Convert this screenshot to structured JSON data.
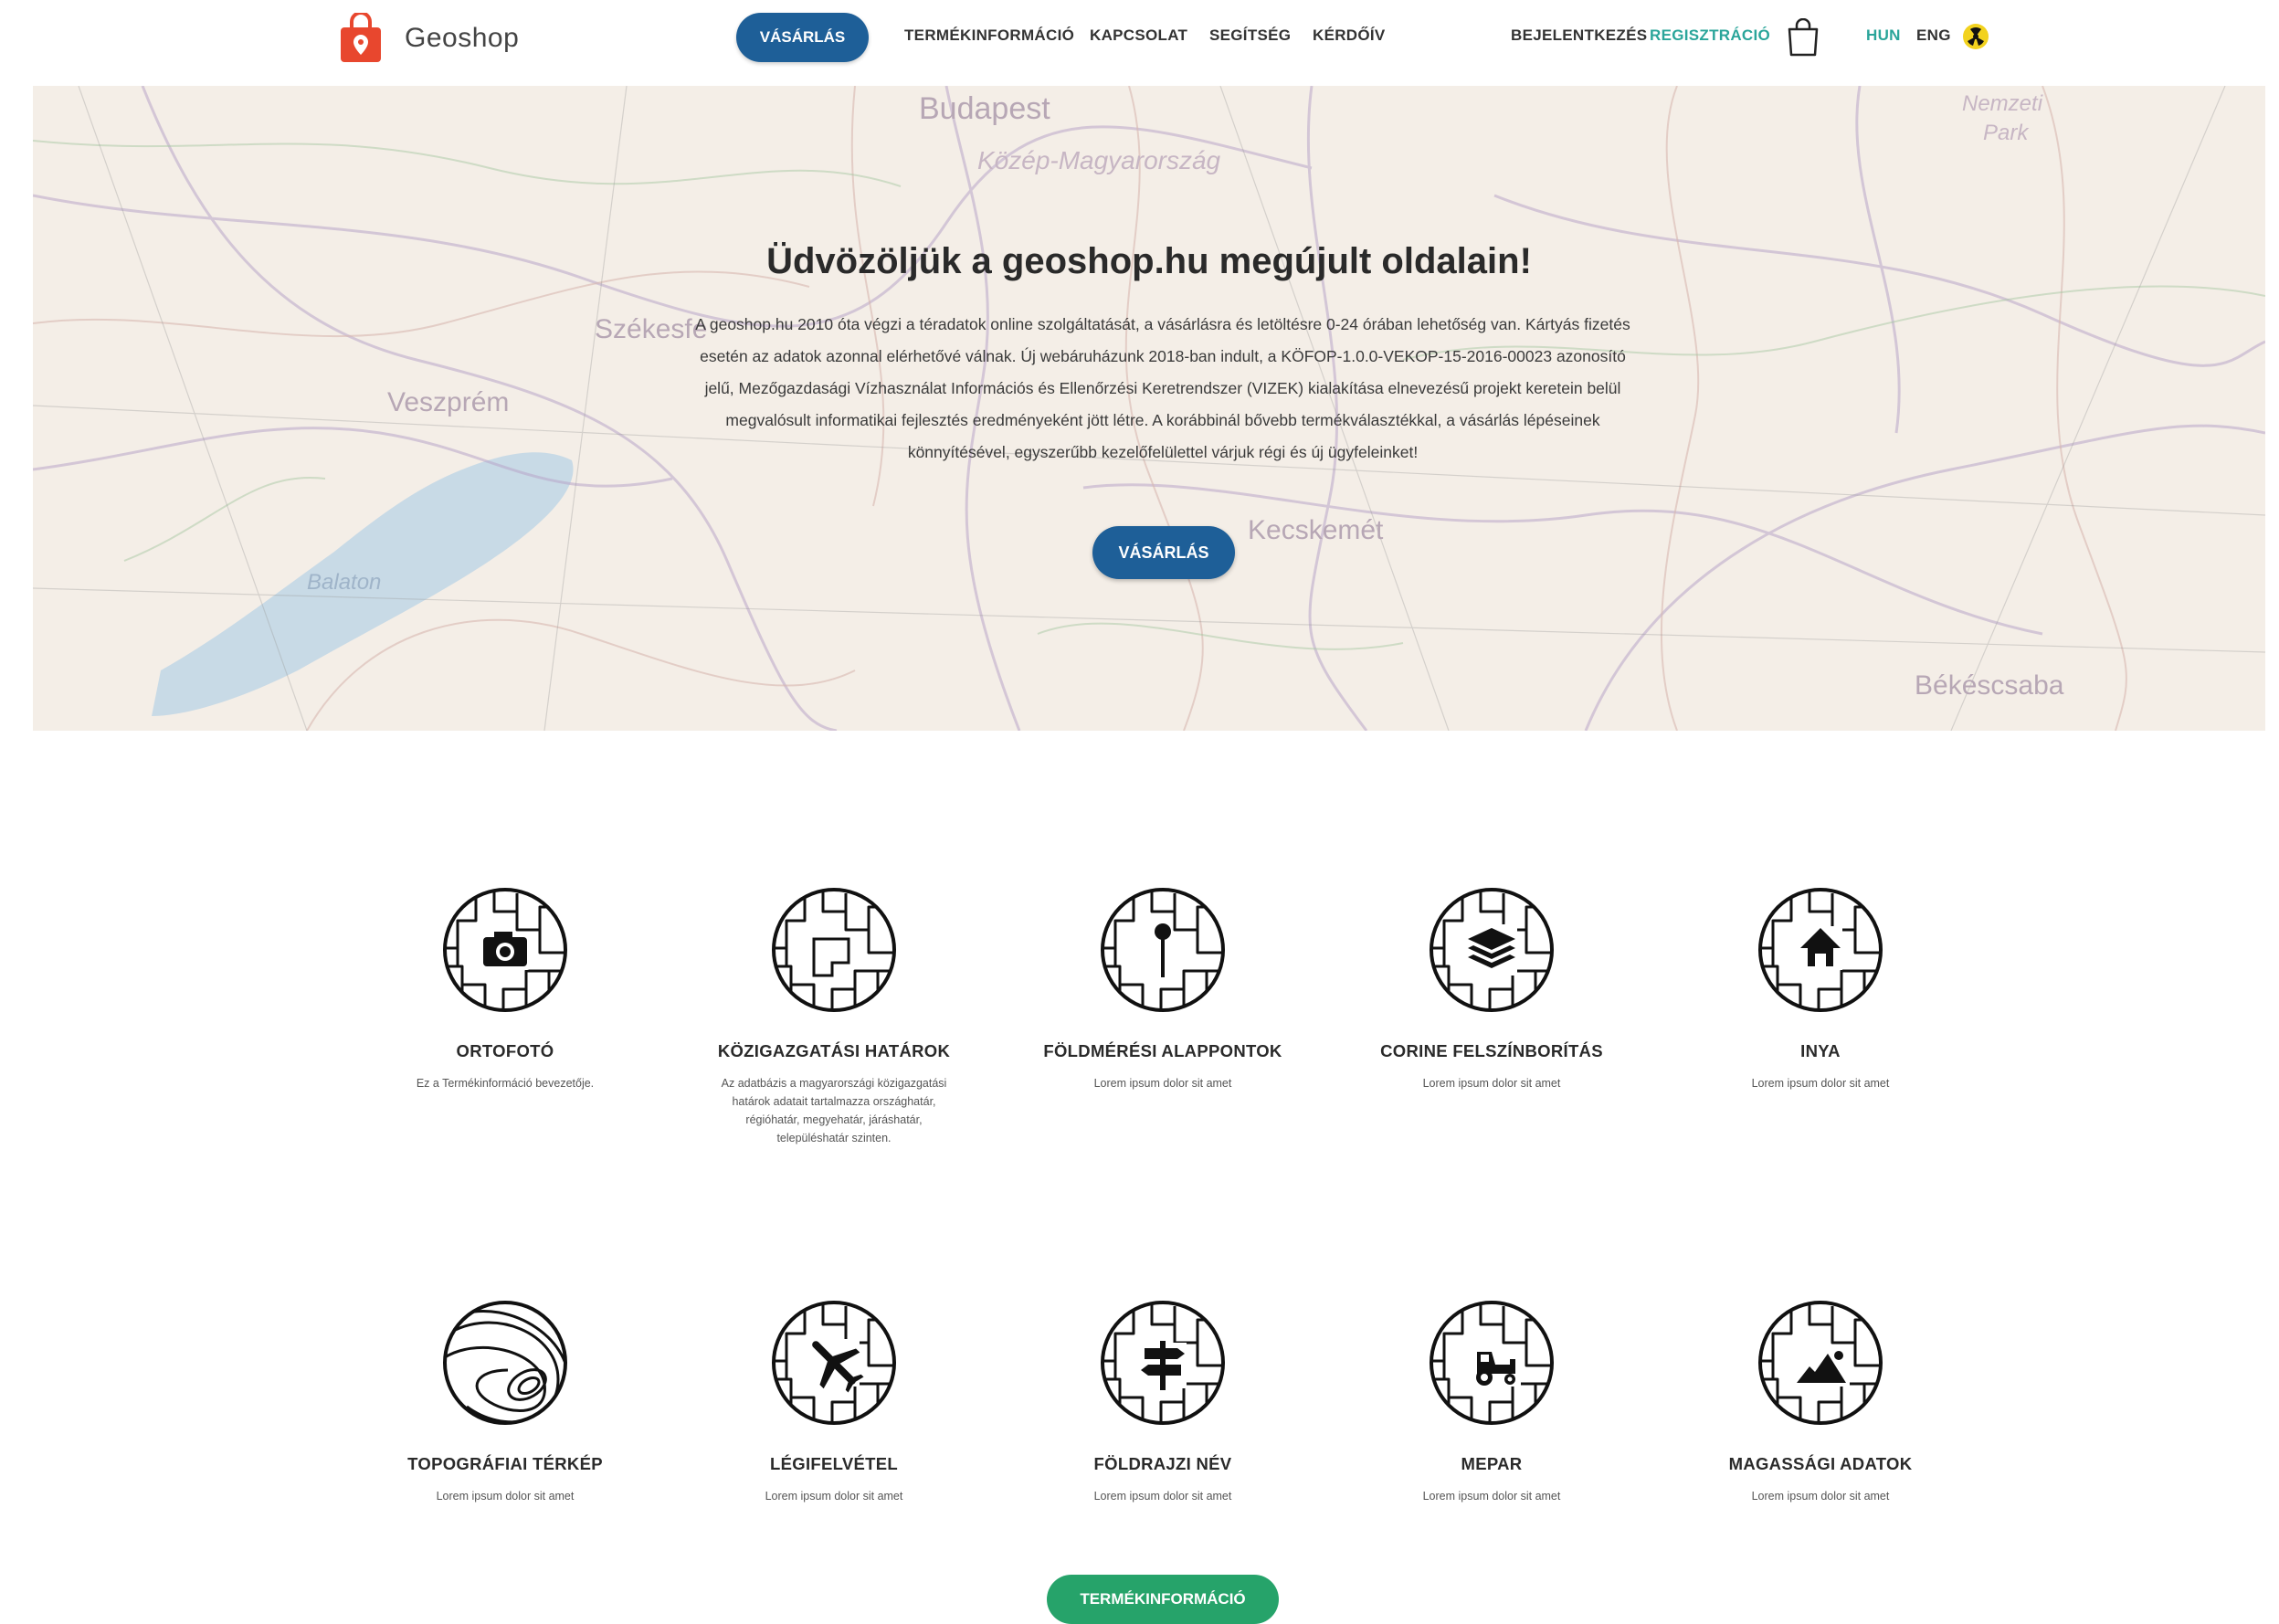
{
  "header": {
    "logo_text": "Geoshop",
    "nav": [
      "VÁSÁRLÁS",
      "TERMÉKINFORMÁCIÓ",
      "KAPCSOLAT",
      "SEGÍTSÉG",
      "KÉRDŐÍV"
    ],
    "login": "BEJELENTKEZÉS",
    "register": "REGISZTRÁCIÓ",
    "lang_hun": "HUN",
    "lang_eng": "ENG",
    "accent_color": "#1e5f98",
    "register_color": "#2aa59a"
  },
  "hero": {
    "map_labels": [
      "Budapest",
      "Közép-Magyarország",
      "Nemzeti",
      "Park",
      "Székesfe",
      "Veszprém",
      "Kecskemét",
      "Balaton",
      "Békéscsaba"
    ],
    "title": "Üdvözöljük a geoshop.hu megújult oldalain!",
    "text": "A geoshop.hu 2010 óta végzi a téradatok online szolgáltatását, a vásárlásra és letöltésre 0-24 órában lehetőség van. Kártyás fizetés esetén az adatok azonnal elérhetővé válnak. Új webáruházunk 2018-ban indult, a KÖFOP-1.0.0-VEKOP-15-2016-00023 azonosító jelű, Mezőgazdasági Vízhasználat Információs és Ellenőrzési Keretrendszer (VIZEK) kialakítása elnevezésű projekt keretein belül megvalósult informatikai fejlesztés eredményeként jött létre. A korábbinál bővebb termékválasztékkal, a vásárlás lépéseinek könnyítésével, egyszerűbb kezelőfelülettel várjuk régi és új ügyfeleinket!",
    "button": "VÁSÁRLÁS"
  },
  "products": [
    {
      "name": "ORTOFOTÓ",
      "desc": "Ez a Termékinformáció bevezetője.",
      "icon": "camera-icon"
    },
    {
      "name": "KÖZIGAZGATÁSI HATÁROK",
      "desc": "Az adatbázis a magyarországi közigazgatási határok adatait tartalmazza országhatár, régióhatár, megyehatár, járáshatár, településhatár szinten.",
      "icon": "map-icon"
    },
    {
      "name": "FÖLDMÉRÉSI ALAPPONTOK",
      "desc": "Lorem ipsum dolor sit amet",
      "icon": "pin-icon"
    },
    {
      "name": "CORINE FELSZÍNBORÍTÁS",
      "desc": "Lorem ipsum dolor sit amet",
      "icon": "layers-icon"
    },
    {
      "name": "INYA",
      "desc": "Lorem ipsum dolor sit amet",
      "icon": "house-icon"
    },
    {
      "name": "TOPOGRÁFIAI TÉRKÉP",
      "desc": "Lorem ipsum dolor sit amet",
      "icon": "contour-icon"
    },
    {
      "name": "LÉGIFELVÉTEL",
      "desc": "Lorem ipsum dolor sit amet",
      "icon": "plane-icon"
    },
    {
      "name": "FÖLDRAJZI NÉV",
      "desc": "Lorem ipsum dolor sit amet",
      "icon": "signpost-icon"
    },
    {
      "name": "MEPAR",
      "desc": "Lorem ipsum dolor sit amet",
      "icon": "tractor-icon"
    },
    {
      "name": "MAGASSÁGI ADATOK",
      "desc": "Lorem ipsum dolor sit amet",
      "icon": "mountain-icon"
    }
  ],
  "bottom_button": "TERMÉKINFORMÁCIÓ",
  "bottom_button_color": "#26a36a"
}
